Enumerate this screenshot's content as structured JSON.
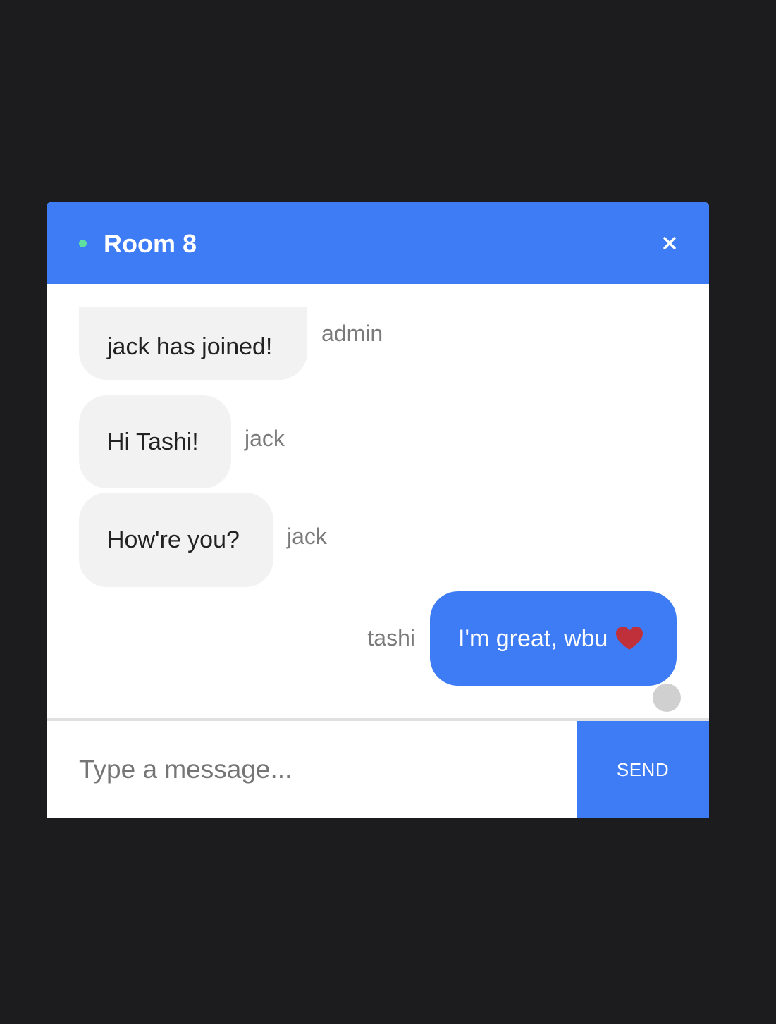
{
  "header": {
    "title": "Room 8",
    "status_color": "#5fe0a0",
    "accent_color": "#3d7cf4",
    "close_icon": "close-icon"
  },
  "messages": [
    {
      "text": "jack has joined!",
      "sender": "admin",
      "own": false
    },
    {
      "text": "Hi Tashi!",
      "sender": "jack",
      "own": false
    },
    {
      "text": "How're you?",
      "sender": "jack",
      "own": false
    },
    {
      "text": "I'm great, wbu",
      "sender": "tashi",
      "own": true,
      "icon": "heart-icon",
      "icon_color": "#c0303a"
    }
  ],
  "composer": {
    "placeholder": "Type a message...",
    "value": "",
    "send_label": "SEND"
  }
}
